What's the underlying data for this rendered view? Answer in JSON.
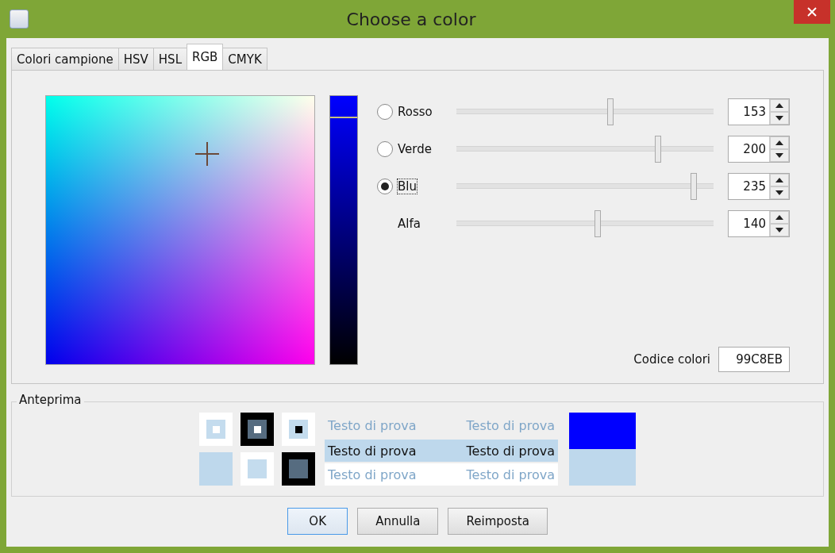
{
  "window": {
    "title": "Choose a color"
  },
  "tabs": [
    {
      "label": "Colori campione",
      "selected": false
    },
    {
      "label": "HSV",
      "selected": false
    },
    {
      "label": "HSL",
      "selected": false
    },
    {
      "label": "RGB",
      "selected": true
    },
    {
      "label": "CMYK",
      "selected": false
    }
  ],
  "channels": [
    {
      "kind": "radio",
      "label": "Rosso",
      "selected": false,
      "level": 0.6,
      "value": "153"
    },
    {
      "kind": "radio",
      "label": "Verde",
      "selected": false,
      "level": 0.784,
      "value": "200"
    },
    {
      "kind": "radio",
      "label": "Blu",
      "selected": true,
      "level": 0.922,
      "value": "235"
    },
    {
      "kind": "plain",
      "label": "Alfa",
      "level": 0.549,
      "value": "140"
    }
  ],
  "color_code": {
    "label": "Codice colori",
    "value": "99C8EB"
  },
  "preview": {
    "title": "Anteprima",
    "rows": [
      {
        "kind": "faded",
        "texts": [
          "Testo di prova",
          "Testo di prova"
        ]
      },
      {
        "kind": "highlighted",
        "texts": [
          "Testo di prova",
          "Testo di prova"
        ]
      },
      {
        "kind": "on-white",
        "texts": [
          "Testo di prova",
          "Testo di prova"
        ]
      }
    ]
  },
  "buttons": [
    {
      "label": "OK",
      "selected": true
    },
    {
      "label": "Annulla",
      "selected": false
    },
    {
      "label": "Reimposta",
      "selected": false
    }
  ]
}
